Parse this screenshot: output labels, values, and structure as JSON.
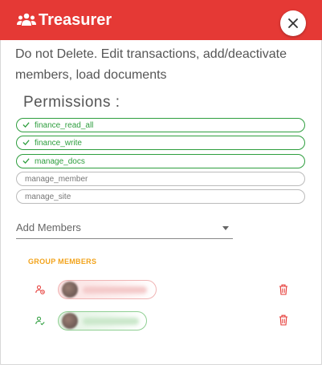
{
  "dialog": {
    "title": "Treasurer",
    "description": "Do not Delete. Edit transactions, add/deactivate members, load documents",
    "close_icon": "close-icon",
    "header_icon": "group-icon",
    "colors": {
      "header": "#e53935",
      "active": "#2e9e3e",
      "group_title": "#f2a31b",
      "delete": "#e53935"
    }
  },
  "permissions": {
    "title": "Permissions :",
    "items": [
      {
        "label": "finance_read_all",
        "active": true
      },
      {
        "label": "finance_write",
        "active": true
      },
      {
        "label": "manage_docs",
        "active": true
      },
      {
        "label": "manage_member",
        "active": false
      },
      {
        "label": "manage_site",
        "active": false
      }
    ]
  },
  "add_members": {
    "placeholder": "Add Members"
  },
  "group_members": {
    "title": "GROUP MEMBERS",
    "members": [
      {
        "status": "pending",
        "icon": "user-pending-icon"
      },
      {
        "status": "active",
        "icon": "user-check-icon"
      }
    ]
  }
}
